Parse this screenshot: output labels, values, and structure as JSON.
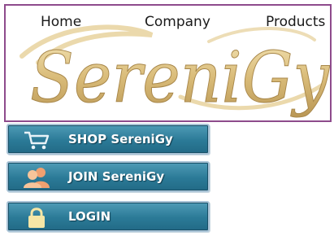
{
  "nav": {
    "items": [
      {
        "label": "Home"
      },
      {
        "label": "Company"
      },
      {
        "label": "Products"
      }
    ]
  },
  "logo": {
    "text": "SereniGy"
  },
  "menu": {
    "shop_label": "SHOP SereniGy",
    "join_label": "JOIN SereniGy",
    "login_label": "LOGIN"
  },
  "colors": {
    "banner_border": "#8e4b8c",
    "button_bg": "#2b7a97",
    "button_border": "#a9c3d6",
    "logo_gold": "#d9bb78"
  },
  "icons": {
    "shop": "cart-icon",
    "join": "users-icon",
    "login": "lock-icon"
  }
}
